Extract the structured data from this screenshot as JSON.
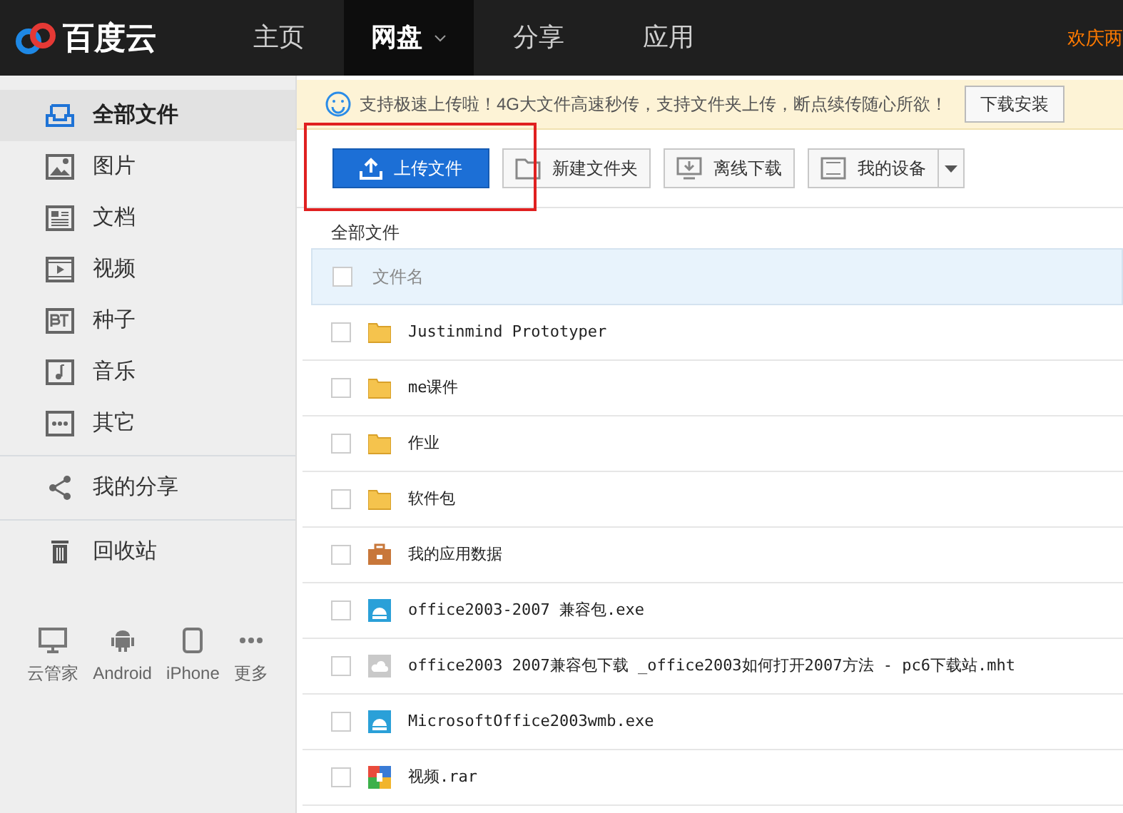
{
  "header": {
    "logo": "百度云",
    "nav": [
      {
        "label": "主页",
        "selected": false,
        "dropdown": false
      },
      {
        "label": "网盘",
        "selected": true,
        "dropdown": true
      },
      {
        "label": "分享",
        "selected": false,
        "dropdown": false
      },
      {
        "label": "应用",
        "selected": false,
        "dropdown": false
      }
    ],
    "promo": "欢庆两"
  },
  "sidebar": {
    "categories": [
      {
        "label": "全部文件",
        "kind": "all",
        "selected": true
      },
      {
        "label": "图片",
        "kind": "image",
        "selected": false
      },
      {
        "label": "文档",
        "kind": "doc",
        "selected": false
      },
      {
        "label": "视频",
        "kind": "video",
        "selected": false
      },
      {
        "label": "种子",
        "kind": "bt",
        "selected": false
      },
      {
        "label": "音乐",
        "kind": "music",
        "selected": false
      },
      {
        "label": "其它",
        "kind": "other",
        "selected": false
      }
    ],
    "share": {
      "label": "我的分享",
      "selected": false
    },
    "recycle": {
      "label": "回收站",
      "selected": false
    },
    "devices": [
      {
        "label": "云管家",
        "kind": "pc"
      },
      {
        "label": "Android",
        "kind": "android"
      },
      {
        "label": "iPhone",
        "kind": "phone"
      },
      {
        "label": "更多",
        "kind": "more"
      }
    ]
  },
  "notice": {
    "text": "支持极速上传啦！4G大文件高速秒传，支持文件夹上传，断点续传随心所欲！",
    "button": "下载安装"
  },
  "toolbar": [
    {
      "label": "上传文件",
      "kind": "upload"
    },
    {
      "label": "新建文件夹",
      "kind": "folder"
    },
    {
      "label": "离线下载",
      "kind": "offline"
    },
    {
      "label": "我的设备",
      "kind": "device"
    }
  ],
  "breadcrumb": "全部文件",
  "table": {
    "header": "文件名",
    "header_checked": false,
    "rows": [
      {
        "name": "Justinmind Prototyper",
        "kind": "folder",
        "checked": false
      },
      {
        "name": "me课件",
        "kind": "folder",
        "checked": false
      },
      {
        "name": "作业",
        "kind": "folder",
        "checked": false
      },
      {
        "name": "软件包",
        "kind": "folder",
        "checked": false
      },
      {
        "name": "我的应用数据",
        "kind": "appdata",
        "checked": false
      },
      {
        "name": "office2003-2007 兼容包.exe",
        "kind": "exe",
        "checked": false
      },
      {
        "name": "office2003 2007兼容包下载 _office2003如何打开2007方法 - pc6下载站.mht",
        "kind": "cloud",
        "checked": false
      },
      {
        "name": "MicrosoftOffice2003wmb.exe",
        "kind": "exe",
        "checked": false
      },
      {
        "name": "视频.rar",
        "kind": "rar",
        "checked": false
      }
    ]
  }
}
